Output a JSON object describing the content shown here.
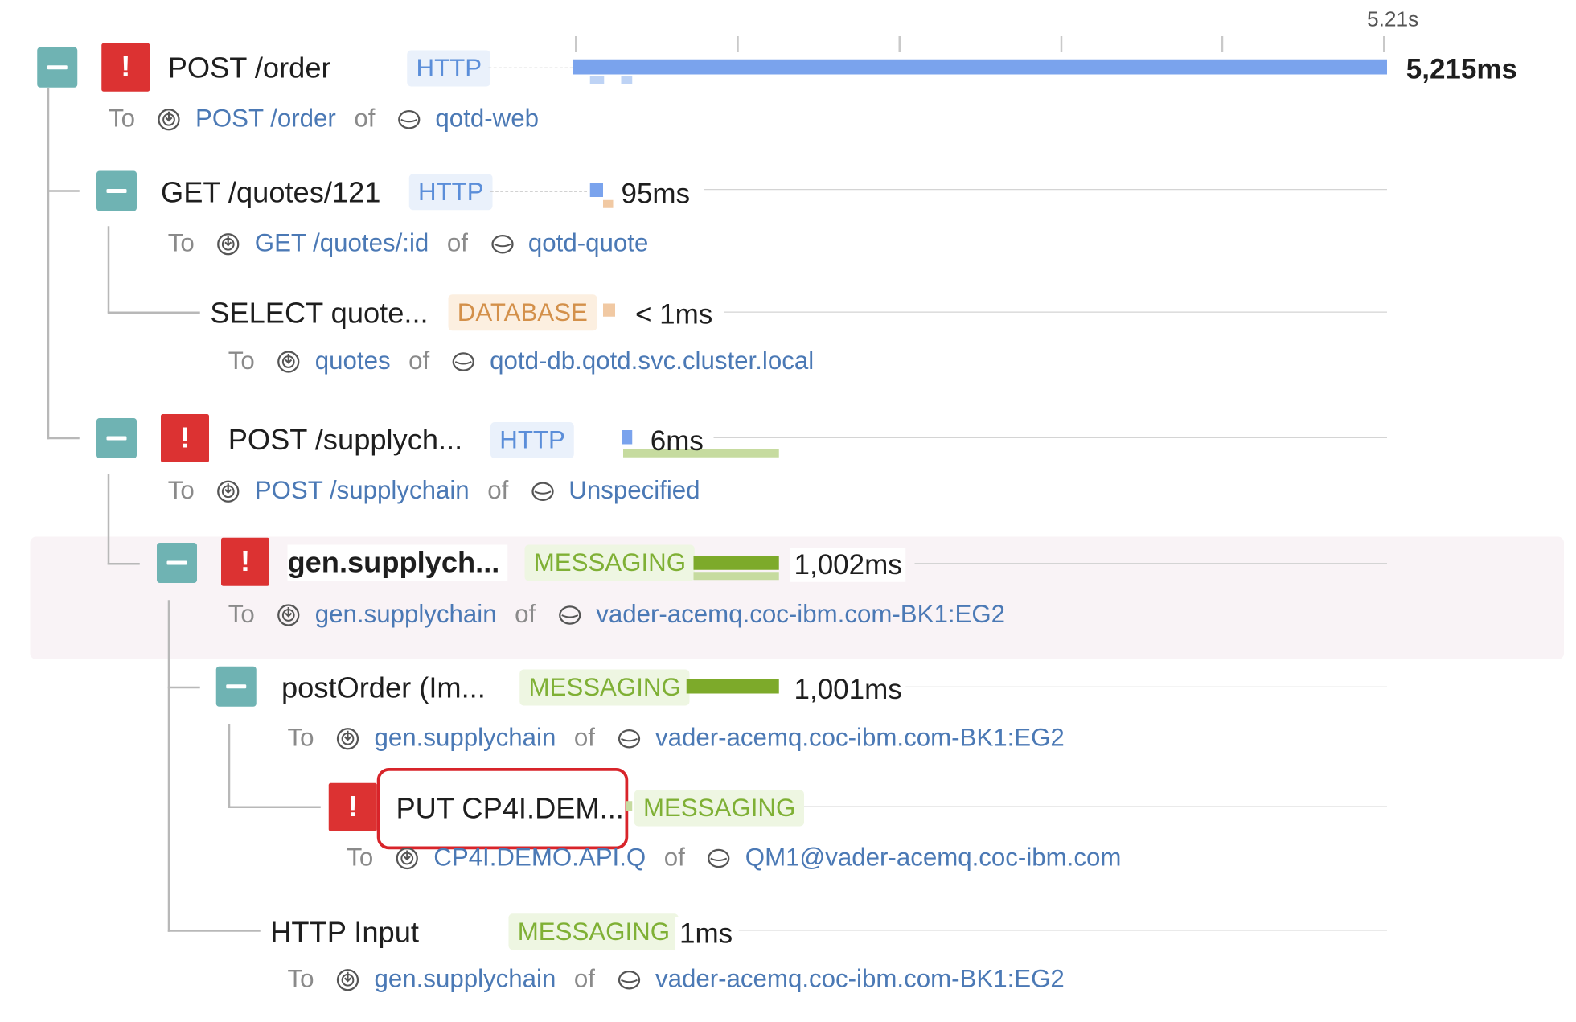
{
  "timeline": {
    "max_label": "5.21s"
  },
  "labels": {
    "to": "To",
    "of": "of"
  },
  "icons": {
    "collapse": "minus-icon",
    "error": "exclamation-icon",
    "endpoint": "endpoint-icon",
    "service": "service-icon"
  },
  "colors": {
    "http": "#5b8ed9",
    "database": "#d3904a",
    "messaging": "#7fb035",
    "error": "#dc3232",
    "toggle": "#6fb3b3",
    "link": "#4b79b5"
  },
  "spans": [
    {
      "name": "POST /order",
      "type": "HTTP",
      "duration": "5,215ms",
      "error": true,
      "endpoint": "POST /order",
      "service": "qotd-web"
    },
    {
      "name": "GET /quotes/121",
      "type": "HTTP",
      "duration": "95ms",
      "error": false,
      "endpoint": "GET /quotes/:id",
      "service": "qotd-quote"
    },
    {
      "name": "SELECT quote...",
      "type": "DATABASE",
      "duration": "< 1ms",
      "error": false,
      "endpoint": "quotes",
      "service": "qotd-db.qotd.svc.cluster.local"
    },
    {
      "name": "POST /supplych...",
      "type": "HTTP",
      "duration": "6ms",
      "error": true,
      "endpoint": "POST /supplychain",
      "service": "Unspecified"
    },
    {
      "name": "gen.supplych...",
      "type": "MESSAGING",
      "duration": "1,002ms",
      "error": true,
      "endpoint": "gen.supplychain",
      "service": "vader-acemq.coc-ibm.com-BK1:EG2"
    },
    {
      "name": "postOrder (Im...",
      "type": "MESSAGING",
      "duration": "1,001ms",
      "error": false,
      "endpoint": "gen.supplychain",
      "service": "vader-acemq.coc-ibm.com-BK1:EG2"
    },
    {
      "name": "PUT CP4I.DEM...",
      "type": "MESSAGING",
      "duration": "",
      "error": true,
      "endpoint": "CP4I.DEMO.API.Q",
      "service": "QM1@vader-acemq.coc-ibm.com"
    },
    {
      "name": "HTTP Input",
      "type": "MESSAGING",
      "duration": "1ms",
      "error": false,
      "endpoint": "gen.supplychain",
      "service": "vader-acemq.coc-ibm.com-BK1:EG2"
    }
  ]
}
